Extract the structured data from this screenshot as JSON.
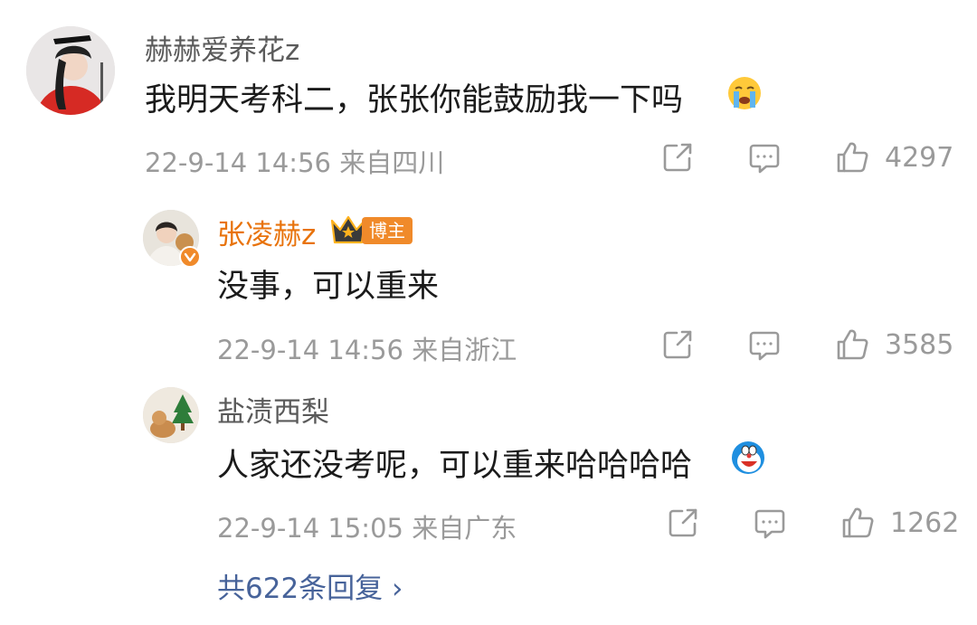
{
  "comment": {
    "username": "赫赫爱养花z",
    "text": "我明天考科二，张张你能鼓励我一下吗",
    "emoji": "crying-face-icon",
    "meta": "22-9-14 14:56 来自四川",
    "likes": "4297"
  },
  "replies": [
    {
      "username": "张凌赫z",
      "badge": "博主",
      "text": "没事，可以重来",
      "meta": "22-9-14 14:56 来自浙江",
      "likes": "3585"
    },
    {
      "username": "盐渍西梨",
      "text": "人家还没考呢，可以重来哈哈哈哈",
      "emoji": "doraemon-laughing-icon",
      "meta": "22-9-14 15:05 来自广东",
      "likes": "1262"
    }
  ],
  "more_replies": "共622条回复 ›",
  "colors": {
    "owner_name": "#e8730c",
    "link": "#47639a",
    "meta": "#9a9a9a",
    "badge": "#f08a2a"
  }
}
